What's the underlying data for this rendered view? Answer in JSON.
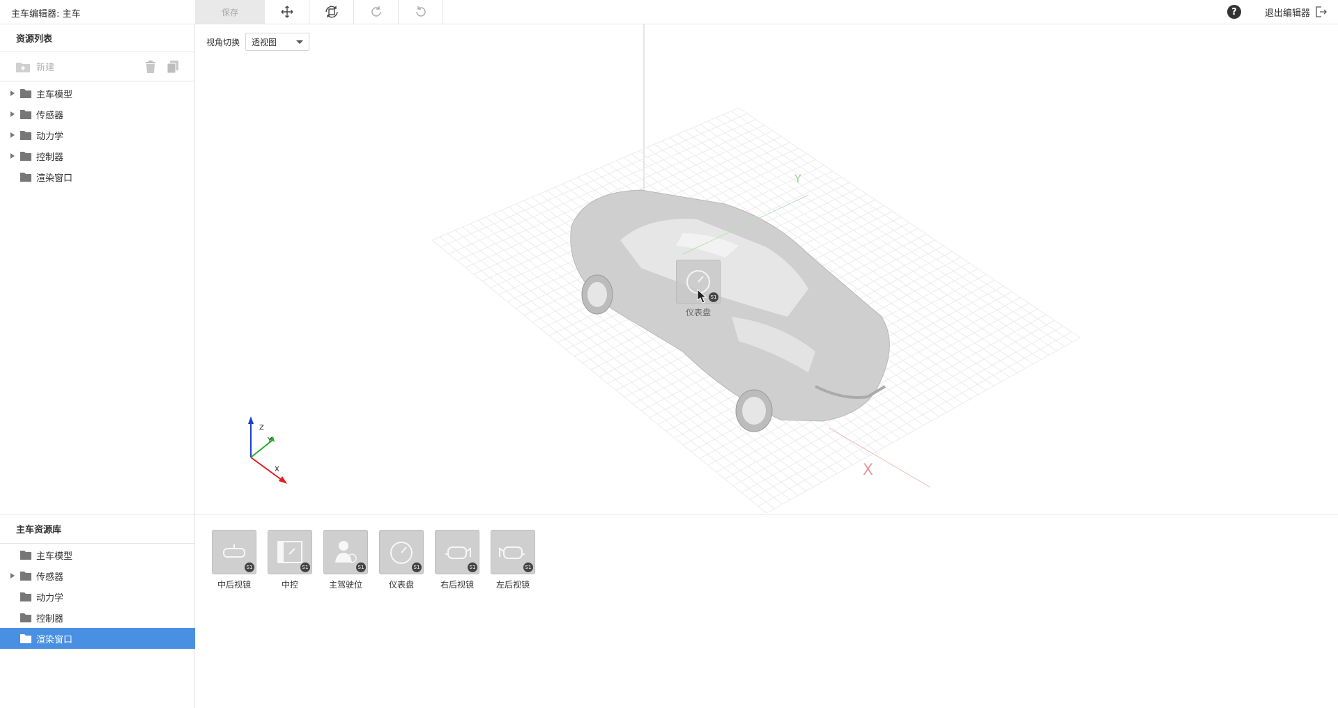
{
  "window": {
    "title": "主车编辑器: 主车"
  },
  "toolbar": {
    "save_label": "保存",
    "tools": [
      "move-icon",
      "rotate-view-icon",
      "redo-icon",
      "undo-icon"
    ]
  },
  "top_right": {
    "help_label": "?",
    "exit_label": "退出编辑器"
  },
  "resource_list": {
    "title": "资源列表",
    "new_label": "新建",
    "items": [
      {
        "label": "主车模型",
        "expandable": true
      },
      {
        "label": "传感器",
        "expandable": true
      },
      {
        "label": "动力学",
        "expandable": true
      },
      {
        "label": "控制器",
        "expandable": true
      },
      {
        "label": "渲染窗口",
        "expandable": false
      }
    ]
  },
  "viewport": {
    "view_switch_label": "视角切换",
    "view_mode": "透视图",
    "axes": {
      "z": "Z",
      "y": "Y",
      "x": "X"
    },
    "dragging_item": "仪表盘"
  },
  "library": {
    "title": "主车资源库",
    "items": [
      {
        "label": "主车模型",
        "expandable": false,
        "selected": false
      },
      {
        "label": "传感器",
        "expandable": true,
        "selected": false
      },
      {
        "label": "动力学",
        "expandable": false,
        "selected": false
      },
      {
        "label": "控制器",
        "expandable": false,
        "selected": false
      },
      {
        "label": "渲染窗口",
        "expandable": false,
        "selected": true
      }
    ],
    "assets": [
      {
        "label": "中后视镜",
        "icon": "rearview-mirror-icon",
        "badge": "S1"
      },
      {
        "label": "中控",
        "icon": "center-console-icon",
        "badge": "S1"
      },
      {
        "label": "主驾驶位",
        "icon": "driver-seat-icon",
        "badge": "S1"
      },
      {
        "label": "仪表盘",
        "icon": "dashboard-icon",
        "badge": "S1"
      },
      {
        "label": "右后视镜",
        "icon": "right-mirror-icon",
        "badge": "S1"
      },
      {
        "label": "左后视镜",
        "icon": "left-mirror-icon",
        "badge": "S1"
      }
    ]
  },
  "colors": {
    "selected": "#4a90e2",
    "axis_x": "#e02020",
    "axis_y": "#20b020",
    "axis_z": "#1a3fd6"
  }
}
